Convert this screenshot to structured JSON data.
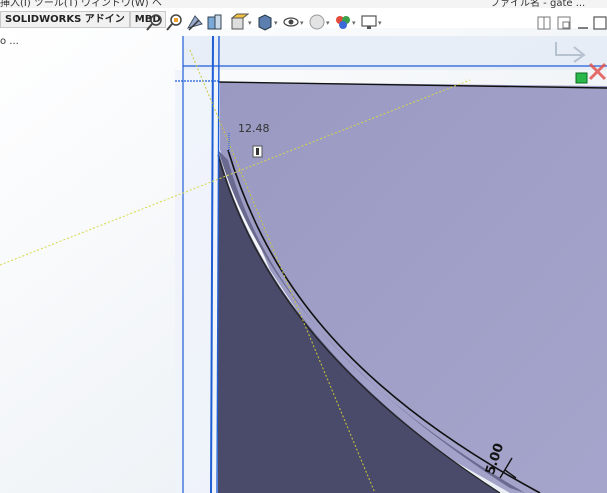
{
  "menubar": {
    "text_left": "挿入(I)  ツール(T)  ウィンドウ(W)  ヘ",
    "text_right": "ファイル名 - gate ..."
  },
  "tabs": [
    {
      "label": "SOLIDWORKS アドイン"
    },
    {
      "label": "MBD"
    }
  ],
  "tree": {
    "label": "o ..."
  },
  "hud": {
    "icons": [
      "zoom-to-fit-icon",
      "zoom-area-icon",
      "previous-view-icon",
      "section-view-icon",
      "view-orientation-icon",
      "display-style-icon",
      "hide-show-icon",
      "edit-appearance-icon",
      "apply-scene-icon",
      "view-settings-icon"
    ]
  },
  "dimensions": {
    "primary": "12.48",
    "secondary": "5.00"
  },
  "colors": {
    "part_face": "#9f9fc6",
    "part_dark": "#4a4a6a",
    "sketch_blue": "#1f5fd6",
    "construction_yellow": "#d8d84a"
  }
}
